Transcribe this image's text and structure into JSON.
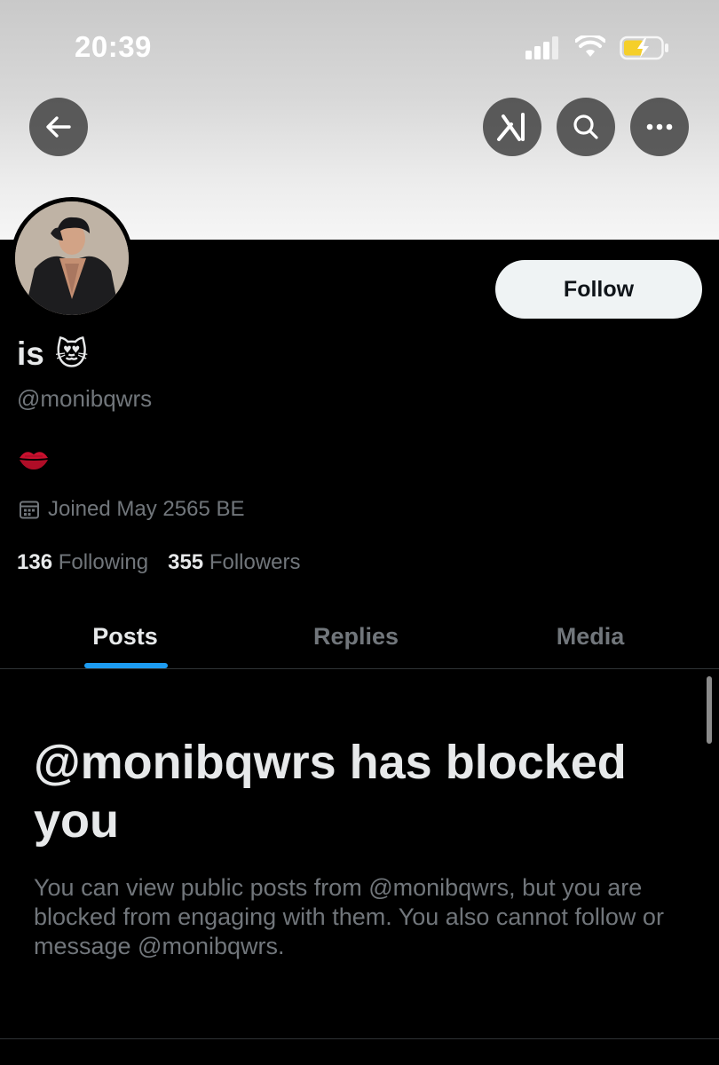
{
  "status_bar": {
    "time": "20:39",
    "icons": [
      "cellular-signal-icon",
      "wifi-icon",
      "battery-charging-icon"
    ]
  },
  "top_nav": {
    "buttons": [
      "back-arrow-icon",
      "grok-icon",
      "search-icon",
      "more-icon"
    ]
  },
  "profile": {
    "display_name": "is",
    "name_emoji": "😻",
    "handle": "@monibqwrs",
    "bio": "💋",
    "joined": "Joined May 2565 BE",
    "following_count": "136",
    "following_label": "Following",
    "followers_count": "355",
    "followers_label": "Followers",
    "follow_button": "Follow"
  },
  "tabs": [
    {
      "label": "Posts",
      "active": true
    },
    {
      "label": "Replies",
      "active": false
    },
    {
      "label": "Media",
      "active": false
    }
  ],
  "blocked_notice": {
    "title": "@monibqwrs has blocked you",
    "body": "You can view public posts from @monibqwrs, but you are blocked from engaging with them. You also cannot follow or message @monibqwrs."
  },
  "colors": {
    "background": "#000000",
    "primary_text": "#e7e9ea",
    "secondary_text": "#71767b",
    "accent": "#1d9bf0",
    "follow_button_bg": "#eff3f4"
  }
}
